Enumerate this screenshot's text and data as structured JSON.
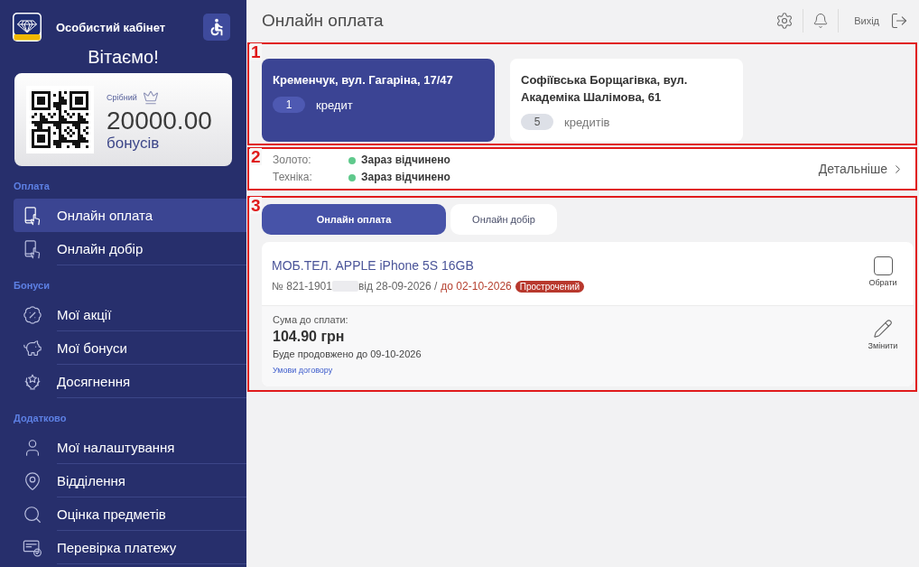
{
  "sidebar": {
    "title": "Особистий кабінет",
    "greeting": "Вітаємо!",
    "bonus_card": {
      "tier": "Срібний",
      "amount": "20000.00",
      "unit": "бонусів"
    },
    "sections": [
      {
        "heading": "Оплата",
        "items": [
          {
            "label": "Онлайн оплата",
            "selected": true
          },
          {
            "label": "Онлайн добір",
            "selected": false
          }
        ]
      },
      {
        "heading": "Бонуси",
        "items": [
          {
            "label": "Мої акції",
            "selected": false
          },
          {
            "label": "Мої бонуси",
            "selected": false
          },
          {
            "label": "Досягнення",
            "selected": false
          }
        ]
      },
      {
        "heading": "Додатково",
        "items": [
          {
            "label": "Мої налаштування",
            "selected": false
          },
          {
            "label": "Відділення",
            "selected": false
          },
          {
            "label": "Оцінка предметів",
            "selected": false
          },
          {
            "label": "Перевірка платежу",
            "selected": false
          }
        ]
      }
    ]
  },
  "header": {
    "title": "Онлайн оплата",
    "logout": "Вихід"
  },
  "branches": {
    "annotation": "1",
    "items": [
      {
        "address": "Кременчук, вул. Гагаріна, 17/47",
        "count": "1",
        "unit": "кредит",
        "selected": true
      },
      {
        "address": "Софіївська Борщагівка, вул. Академіка Шалімова, 61",
        "count": "5",
        "unit": "кредитів",
        "selected": false
      }
    ]
  },
  "schedule": {
    "annotation": "2",
    "rows": [
      {
        "label": "Золото:",
        "status": "Зараз відчинено",
        "open": true
      },
      {
        "label": "Техніка:",
        "status": "Зараз відчинено",
        "open": true
      }
    ],
    "more_link": "Детальніше"
  },
  "contracts": {
    "annotation": "3",
    "tabs": [
      {
        "label": "Онлайн оплата",
        "selected": true
      },
      {
        "label": "Онлайн добір",
        "selected": false
      }
    ],
    "items": [
      {
        "title": "МОБ.ТЕЛ. APPLE iPhone 5S 16GB",
        "number": "№ 821-1901",
        "issued": "від 28-09-2026 /",
        "due": "до 02-10-2026",
        "overdue": true,
        "status": "Прострочений",
        "select_label": "Обрати",
        "checked": false,
        "amount_label": "Сума до сплати:",
        "amount": "104.90 грн",
        "extension": "Буде продовжено до 09-10-2026",
        "terms_link": "Умови договору",
        "edit_label": "Змінити"
      }
    ]
  }
}
